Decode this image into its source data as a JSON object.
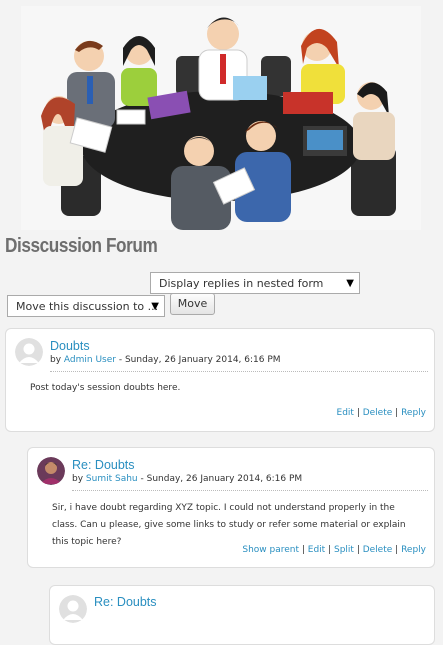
{
  "forum_title": "Disscussion Forum",
  "display_mode": {
    "selected": "Display replies in nested form"
  },
  "move": {
    "selected": "Move this discussion to ...",
    "button": "Move"
  },
  "posts": [
    {
      "subject": "Doubts",
      "by": "by",
      "author": "Admin User",
      "date": " - Sunday, 26 January 2014, 6:16 PM",
      "message": "Post today's session doubts here.",
      "commands": [
        "Edit",
        "Delete",
        "Reply"
      ]
    },
    {
      "subject": "Re: Doubts",
      "by": "by",
      "author": "Sumit Sahu",
      "date": " - Sunday, 26 January 2014, 6:16 PM",
      "message": "Sir, i have doubt regarding XYZ topic. I could not understand properly in the class. Can u please, give some links to study or refer some material or explain this topic here?",
      "commands": [
        "Show parent",
        "Edit",
        "Split",
        "Delete",
        "Reply"
      ]
    },
    {
      "subject": "Re: Doubts"
    }
  ],
  "icons": {
    "avatar_default": "default-user-icon",
    "avatar_photo": "user-photo-icon",
    "dropdown": "dropdown-arrow-icon"
  },
  "colors": {
    "link": "#2a8fc0",
    "title": "#6e6e6e"
  }
}
